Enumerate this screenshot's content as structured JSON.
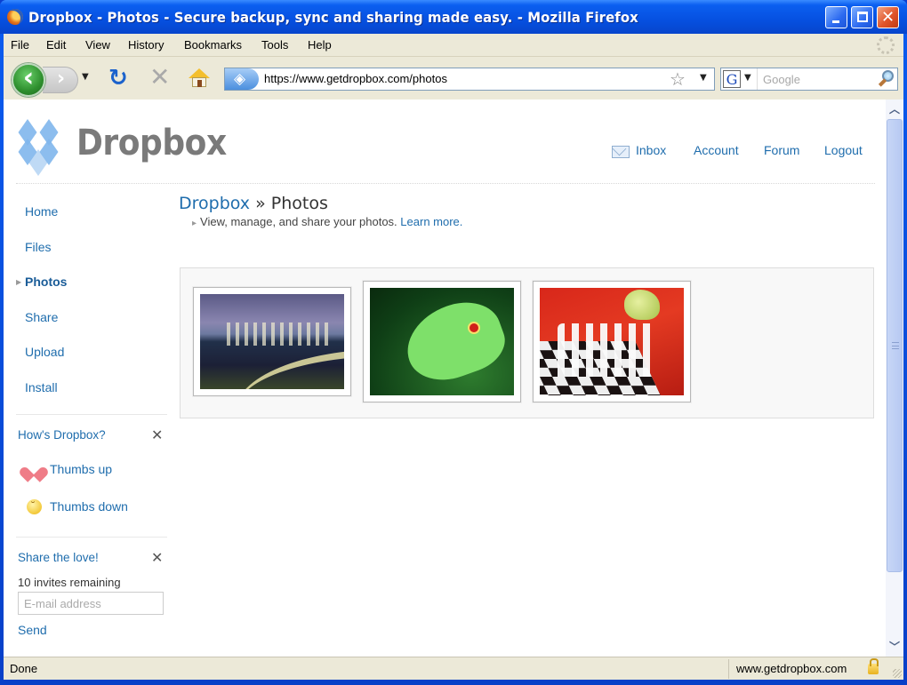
{
  "window": {
    "title": "Dropbox - Photos - Secure backup, sync and sharing made easy. - Mozilla Firefox",
    "controls": [
      "minimize",
      "maximize",
      "close"
    ]
  },
  "menubar": {
    "items": [
      {
        "label": "File",
        "accel": "F"
      },
      {
        "label": "Edit",
        "accel": "E"
      },
      {
        "label": "View",
        "accel": "V"
      },
      {
        "label": "History",
        "accel": "s"
      },
      {
        "label": "Bookmarks",
        "accel": "B"
      },
      {
        "label": "Tools",
        "accel": "T"
      },
      {
        "label": "Help",
        "accel": "H"
      }
    ]
  },
  "navbar": {
    "url": "https://www.getdropbox.com/photos",
    "search_placeholder": "Google",
    "search_engine_glyph": "G",
    "icons": {
      "back": "back-arrow-icon",
      "forward": "forward-arrow-icon",
      "reload": "reload-icon",
      "stop": "stop-icon",
      "home": "home-icon",
      "bookmark": "star-icon",
      "search": "magnifier-icon"
    }
  },
  "page": {
    "logo_text": "Dropbox",
    "topnav": [
      {
        "label": "Inbox",
        "icon": "mail-icon"
      },
      {
        "label": "Account"
      },
      {
        "label": "Forum"
      },
      {
        "label": "Logout"
      }
    ],
    "sidebar": {
      "items": [
        {
          "label": "Home",
          "active": false
        },
        {
          "label": "Files",
          "active": false
        },
        {
          "label": "Photos",
          "active": true
        },
        {
          "label": "Share",
          "active": false
        },
        {
          "label": "Upload",
          "active": false
        },
        {
          "label": "Install",
          "active": false
        }
      ],
      "feedback_box": {
        "title": "How's Dropbox?",
        "thumbs_up": "Thumbs up",
        "thumbs_down": "Thumbs down"
      },
      "invite_box": {
        "title": "Share the love!",
        "remaining": "10 invites remaining",
        "email_placeholder": "E-mail address",
        "send_label": "Send"
      }
    },
    "breadcrumb": {
      "root": "Dropbox",
      "separator": "»",
      "current": "Photos"
    },
    "subtitle": "View, manage, and share your photos.",
    "learn_more": "Learn more.",
    "photos": [
      {
        "subject": "city skyline at night with light trails"
      },
      {
        "subject": "red-eyed tree frog on leaf"
      },
      {
        "subject": "bird over chess board on red background"
      }
    ]
  },
  "statusbar": {
    "text": "Done",
    "domain": "www.getdropbox.com"
  },
  "colors": {
    "link": "#1f6dad",
    "titlebar": "#0650e0",
    "chrome": "#ece9d8"
  }
}
